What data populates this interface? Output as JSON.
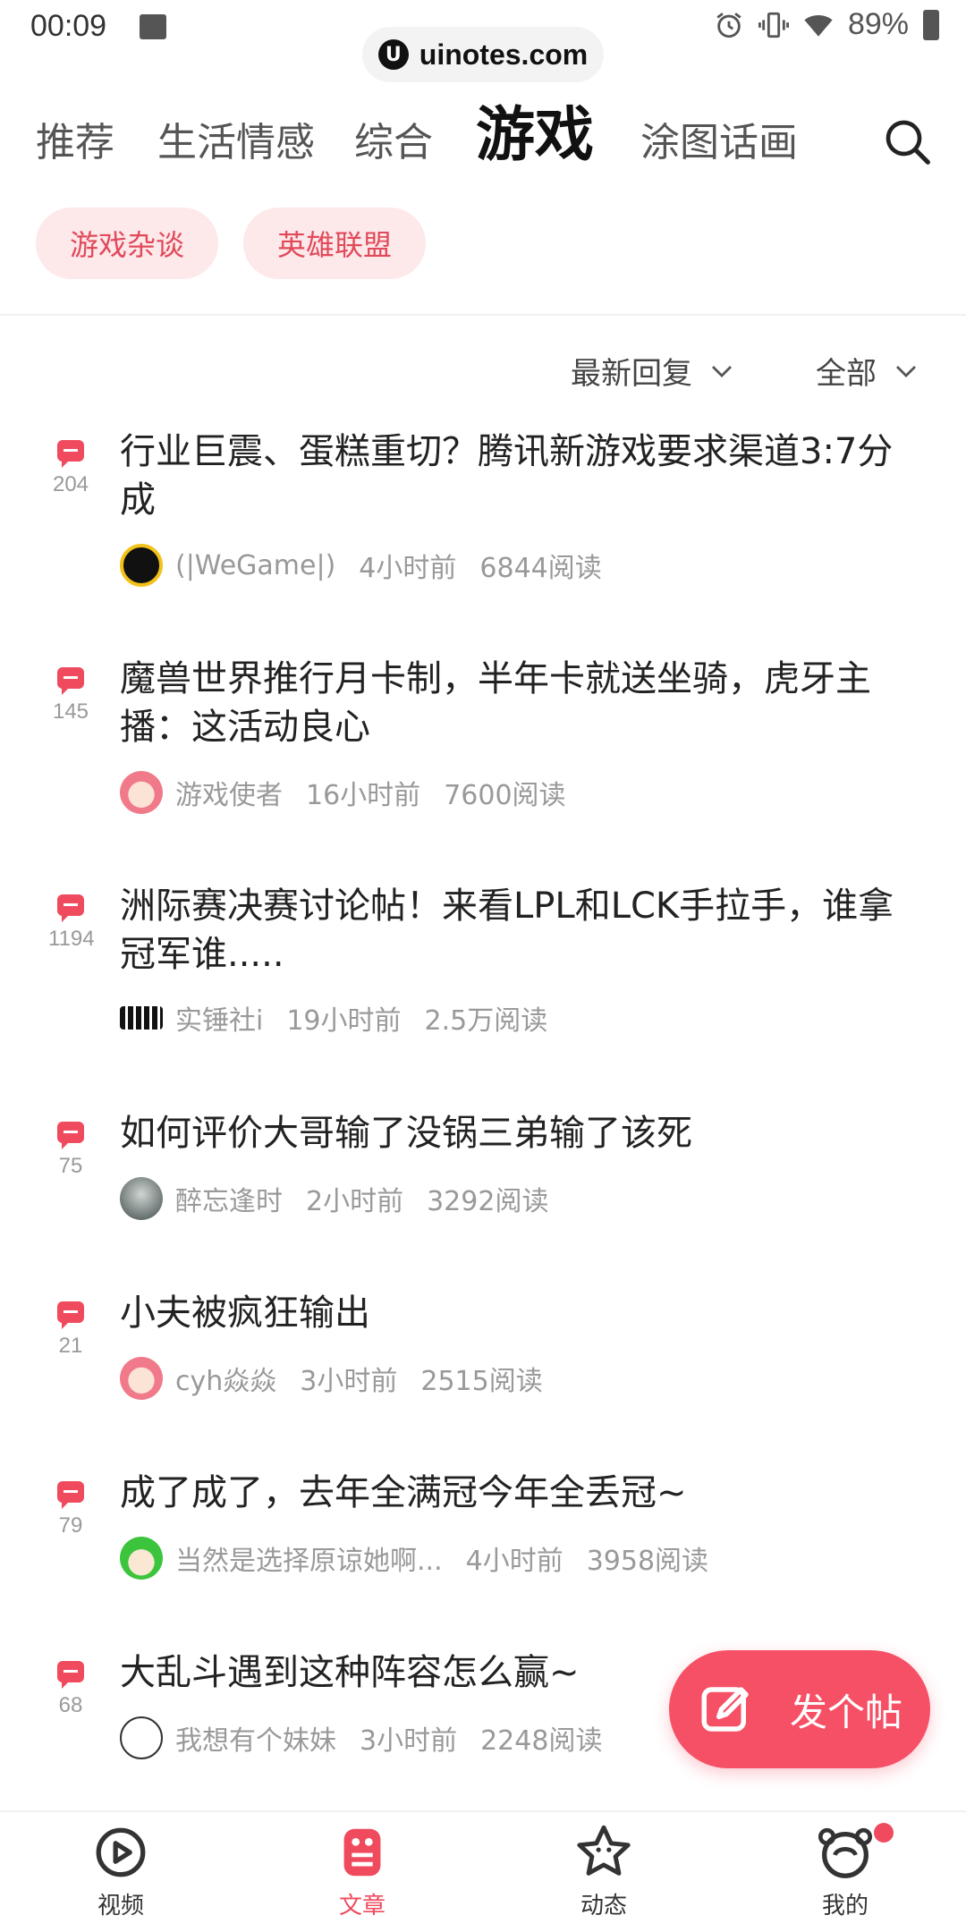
{
  "status_bar": {
    "time": "00:09",
    "battery": "89%"
  },
  "url_pill": {
    "text": "uinotes.com"
  },
  "tabs": [
    {
      "label": "推荐"
    },
    {
      "label": "生活情感"
    },
    {
      "label": "综合"
    },
    {
      "label": "游戏"
    },
    {
      "label": "涂图话画"
    }
  ],
  "active_tab": "游戏",
  "chips": [
    {
      "label": "游戏杂谈"
    },
    {
      "label": "英雄联盟"
    }
  ],
  "filters": {
    "sort": "最新回复",
    "scope": "全部"
  },
  "posts": [
    {
      "count": "204",
      "title": "行业巨震、蛋糕重切？腾讯新游戏要求渠道3:7分成",
      "author": "(|WeGame|)",
      "time": "4小时前",
      "reads": "6844阅读"
    },
    {
      "count": "145",
      "title": "魔兽世界推行月卡制，半年卡就送坐骑，虎牙主播：这活动良心",
      "author": "游戏使者",
      "time": "16小时前",
      "reads": "7600阅读"
    },
    {
      "count": "1194",
      "title": "洲际赛决赛讨论帖！来看LPL和LCK手拉手，谁拿冠军谁.....",
      "author": "实锤社i",
      "time": "19小时前",
      "reads": "2.5万阅读"
    },
    {
      "count": "75",
      "title": "如何评价大哥输了没锅三弟输了该死",
      "author": "醉忘逢时",
      "time": "2小时前",
      "reads": "3292阅读"
    },
    {
      "count": "21",
      "title": "小夫被疯狂输出",
      "author": "cyh焱焱",
      "time": "3小时前",
      "reads": "2515阅读"
    },
    {
      "count": "79",
      "title": "成了成了，去年全满冠今年全丢冠~",
      "author": "当然是选择原谅她啊...",
      "time": "4小时前",
      "reads": "3958阅读"
    },
    {
      "count": "68",
      "title": "大乱斗遇到这种阵容怎么赢~",
      "author": "我想有个妹妹",
      "time": "3小时前",
      "reads": "2248阅读"
    }
  ],
  "fab": {
    "label": "发个帖"
  },
  "bottom_nav": [
    {
      "label": "视频",
      "icon": "video-icon"
    },
    {
      "label": "文章",
      "icon": "article-icon"
    },
    {
      "label": "动态",
      "icon": "feed-icon"
    },
    {
      "label": "我的",
      "icon": "profile-icon"
    }
  ],
  "colors": {
    "accent": "#f04a5e",
    "chip_bg": "#fde8ea",
    "tab_underline": "#f6b6c0"
  }
}
